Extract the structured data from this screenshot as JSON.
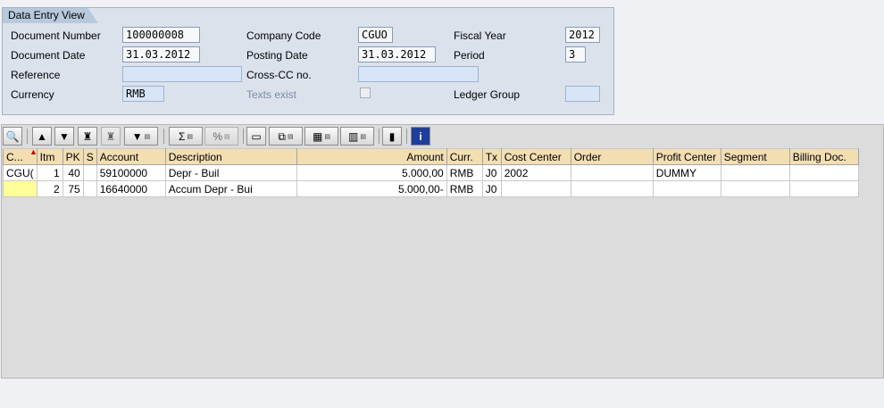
{
  "header": {
    "tab_title": "Data Entry View",
    "document_number": {
      "label": "Document Number",
      "value": "100000008"
    },
    "company_code": {
      "label": "Company Code",
      "value": "CGUO"
    },
    "fiscal_year": {
      "label": "Fiscal Year",
      "value": "2012"
    },
    "document_date": {
      "label": "Document Date",
      "value": "31.03.2012"
    },
    "posting_date": {
      "label": "Posting Date",
      "value": "31.03.2012"
    },
    "period": {
      "label": "Period",
      "value": "3"
    },
    "reference": {
      "label": "Reference",
      "value": ""
    },
    "cross_cc": {
      "label": "Cross-CC no.",
      "value": ""
    },
    "currency": {
      "label": "Currency",
      "value": "RMB"
    },
    "texts_exist": {
      "label": "Texts exist",
      "checked": false
    },
    "ledger_group": {
      "label": "Ledger Group",
      "value": ""
    }
  },
  "toolbar": {
    "buttons": [
      {
        "name": "details-icon"
      },
      {
        "name": "print-icon"
      },
      {
        "name": "filter-icon"
      },
      {
        "name": "find-icon"
      },
      {
        "name": "find-next-icon"
      },
      {
        "name": "set-filter-icon"
      },
      {
        "name": "sum-icon"
      },
      {
        "name": "subtotals-icon"
      },
      {
        "name": "print-preview-icon"
      },
      {
        "name": "export-icon"
      },
      {
        "name": "spreadsheet-icon"
      },
      {
        "name": "change-layout-icon"
      },
      {
        "name": "graphic-icon"
      },
      {
        "name": "information-icon"
      }
    ]
  },
  "table": {
    "columns": [
      "C...",
      "Itm",
      "PK",
      "S",
      "Account",
      "Description",
      "Amount",
      "Curr.",
      "Tx",
      "Cost Center",
      "Order",
      "Profit Center",
      "Segment",
      "Billing Doc."
    ],
    "rows": [
      [
        "CGU(",
        "1",
        "40",
        "",
        "59100000",
        "Depr - Buil",
        "5.000,00",
        "RMB",
        "J0",
        "2002",
        "",
        "DUMMY",
        "",
        ""
      ],
      [
        "",
        "2",
        "75",
        "",
        "16640000",
        "Accum Depr - Bui",
        "5.000,00-",
        "RMB",
        "J0",
        "",
        "",
        "",
        "",
        ""
      ]
    ]
  }
}
